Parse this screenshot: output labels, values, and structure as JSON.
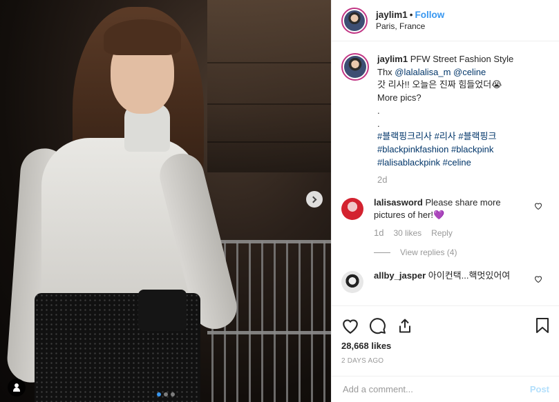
{
  "post": {
    "username": "jaylim1",
    "separator": "•",
    "follow_label": "Follow",
    "location": "Paris, France"
  },
  "caption": {
    "username": "jaylim1",
    "line1": "PFW Street Fashion Style",
    "thx": "Thx",
    "mention1": "@lalalalisa_m",
    "mention2": "@celine",
    "korean": "갓 리사!! 오늘은 진짜 힘들었더😭",
    "more": "More pics?",
    "dot1": ".",
    "dot2": ".",
    "hashtags1": "#블랙핑크리사 #리사 #블랙핑크",
    "hashtags2": "#blackpinkfashion #blackpink",
    "hashtags3": "#lalisablackpink #celine",
    "time": "2d"
  },
  "comments": [
    {
      "username": "lalisasword",
      "text": "Please share more pictures of her!💜",
      "time": "1d",
      "likes": "30 likes",
      "reply": "Reply",
      "view_replies": "View replies (4)"
    },
    {
      "username": "allby_jasper",
      "text": "아이컨택...핵멋있어여"
    }
  ],
  "stats": {
    "likes": "28,668 likes",
    "posted": "2 DAYS AGO"
  },
  "add_comment": {
    "placeholder": "Add a comment...",
    "post_label": "Post"
  },
  "carousel": {
    "dots": 3,
    "active": 0,
    "accent": "#3897f0"
  },
  "icons": [
    "chevron-right-icon",
    "user-tag-icon",
    "heart-icon",
    "comment-icon",
    "share-icon",
    "bookmark-icon"
  ]
}
